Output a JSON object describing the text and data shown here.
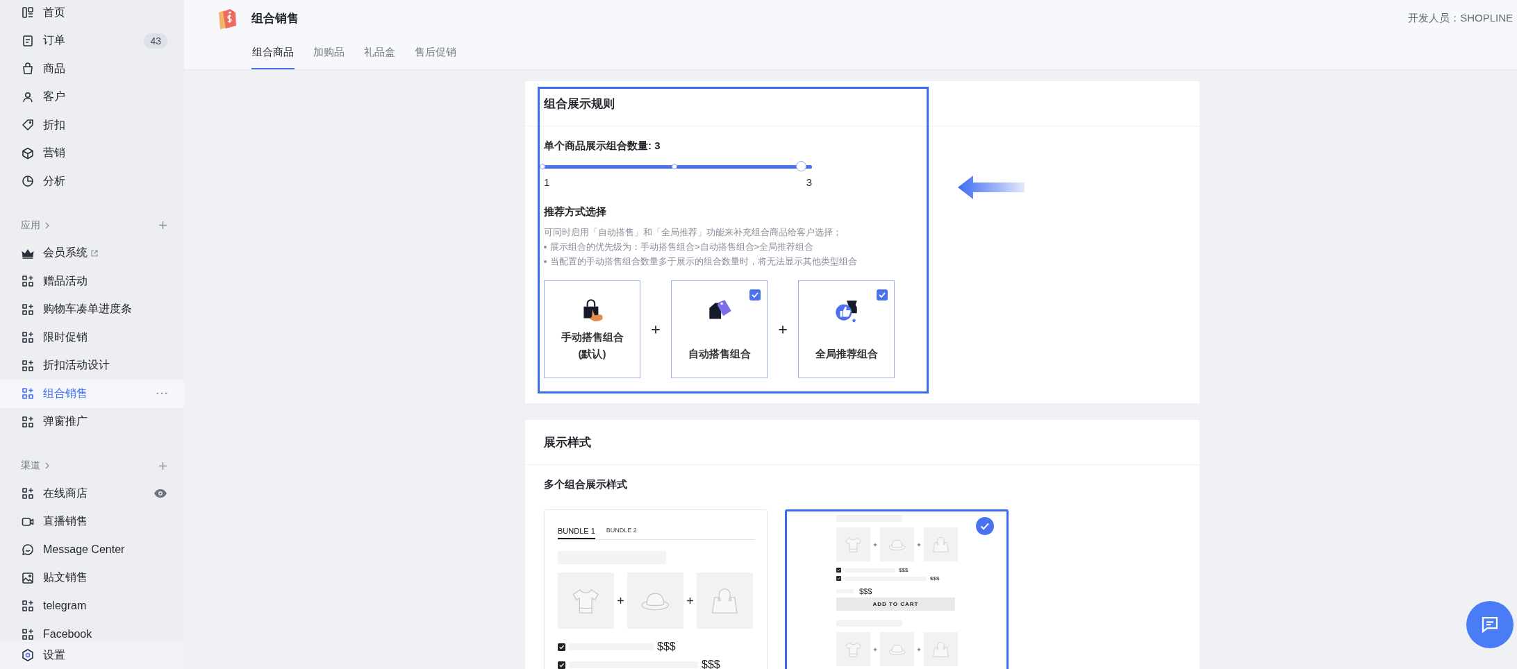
{
  "sidebar": {
    "items": [
      {
        "label": "首页",
        "selected": false
      },
      {
        "label": "订单",
        "badge": "43",
        "selected": false
      },
      {
        "label": "商品",
        "selected": false
      },
      {
        "label": "客户",
        "selected": false
      },
      {
        "label": "折扣",
        "selected": false
      },
      {
        "label": "营销",
        "selected": false
      },
      {
        "label": "分析",
        "selected": false
      }
    ],
    "sections": [
      {
        "heading": "应用",
        "items": [
          {
            "label": "会员系统",
            "selected": false
          },
          {
            "label": "赠品活动",
            "selected": false
          },
          {
            "label": "购物车凑单进度条",
            "selected": false
          },
          {
            "label": "限时促销",
            "selected": false
          },
          {
            "label": "折扣活动设计",
            "selected": false
          },
          {
            "label": "组合销售",
            "selected": true
          },
          {
            "label": "弹窗推广",
            "selected": false
          }
        ]
      },
      {
        "heading": "渠道",
        "items": [
          {
            "label": "在线商店",
            "selected": false
          },
          {
            "label": "直播销售",
            "selected": false
          },
          {
            "label": "Message Center",
            "selected": false
          },
          {
            "label": "贴文销售",
            "selected": false
          },
          {
            "label": "telegram",
            "selected": false
          },
          {
            "label": "Facebook",
            "selected": false
          }
        ]
      }
    ],
    "footer_item": {
      "label": "设置",
      "selected": false
    }
  },
  "header": {
    "title": "组合销售",
    "developer": "开发人员：SHOPLINE"
  },
  "tabs": [
    {
      "label": "组合商品",
      "selected": true
    },
    {
      "label": "加购品",
      "selected": false
    },
    {
      "label": "礼品盒",
      "selected": false
    },
    {
      "label": "售后促销",
      "selected": false
    }
  ],
  "rules_card": {
    "title": "组合展示规则",
    "slider": {
      "label": "单个商品展示组合数量: 3",
      "level": 1,
      "min_label": "1",
      "max_label": "3"
    },
    "method_title": "推荐方式选择",
    "intro": "可同时启用「自动搭售」和「全局推荐」功能来补充组合商品给客户选择；",
    "bullets": [
      "展示组合的优先级为：手动搭售组合>自动搭售组合>全局推荐组合",
      "当配置的手动搭售组合数量多于展示的组合数量时，将无法显示其他类型组合"
    ],
    "methods": [
      {
        "label": "手动搭售组合",
        "note": "(默认)",
        "checked": false
      },
      {
        "label": "自动搭售组合",
        "checked": true
      },
      {
        "label": "全局推荐组合",
        "checked": true
      }
    ]
  },
  "style_card": {
    "title": "展示样式",
    "subtitle": "多个组合展示样式",
    "options": [
      {
        "kind": "tabs",
        "selected": false,
        "tabs": [
          {
            "label": "BUNDLE 1",
            "selected": true
          },
          {
            "label": "BUNDLE 2",
            "selected": false
          }
        ],
        "prices": [
          "$$$",
          "$$$"
        ]
      },
      {
        "kind": "stacked",
        "selected": true,
        "prices": [
          "$$$",
          "$$$"
        ],
        "total": "$$$",
        "button": "ADD TO CART"
      }
    ]
  }
}
